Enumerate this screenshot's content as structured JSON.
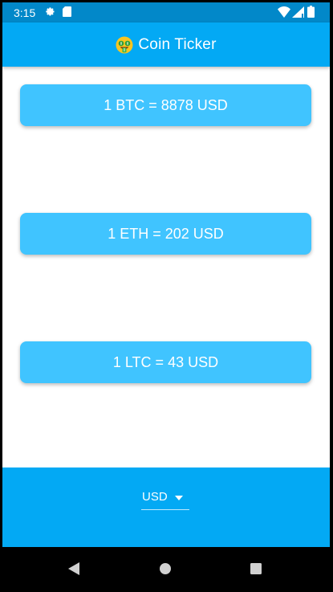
{
  "status_bar": {
    "time": "3:15",
    "icons": [
      "gear-icon",
      "sd-card-icon",
      "wifi-icon",
      "signal-icon",
      "battery-icon"
    ]
  },
  "app_bar": {
    "title": "Coin Ticker",
    "icon": "money-face-emoji-icon"
  },
  "rates": [
    {
      "label": "1 BTC = 8878 USD"
    },
    {
      "label": "1 ETH = 202 USD"
    },
    {
      "label": "1 LTC = 43 USD"
    }
  ],
  "currency_picker": {
    "selected": "USD"
  },
  "nav_bar": {
    "icons": [
      "back-icon",
      "home-icon",
      "recents-icon"
    ]
  },
  "colors": {
    "status_bar": "#0288c9",
    "primary": "#03a9f4",
    "card": "#40c4ff",
    "text_on_primary": "#ffffff"
  }
}
